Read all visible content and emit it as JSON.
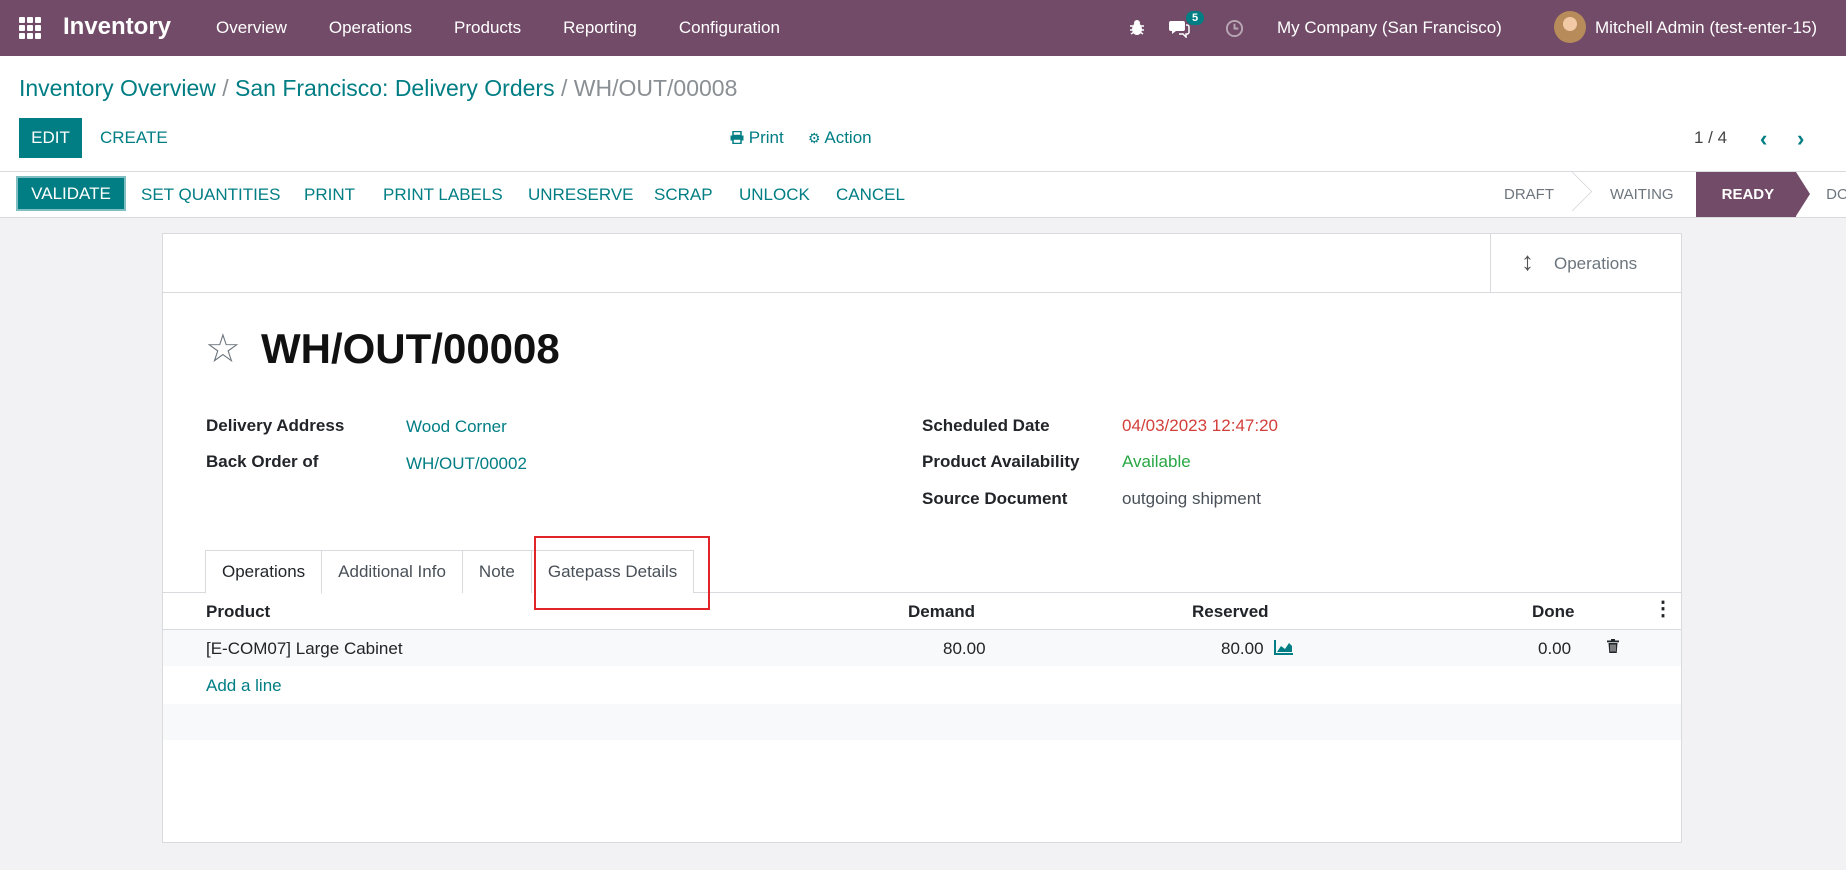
{
  "navbar": {
    "brand": "Inventory",
    "menu": [
      "Overview",
      "Operations",
      "Products",
      "Reporting",
      "Configuration"
    ],
    "messages_count": "5",
    "company": "My Company (San Francisco)",
    "user": "Mitchell Admin (test-enter-15)"
  },
  "breadcrumb": {
    "level1": "Inventory Overview",
    "level2": "San Francisco: Delivery Orders",
    "current": "WH/OUT/00008",
    "sep": "/"
  },
  "controls": {
    "edit": "EDIT",
    "create": "CREATE",
    "print": "Print",
    "action": "Action",
    "pager": "1 / 4"
  },
  "statusbar": {
    "buttons": [
      "VALIDATE",
      "SET QUANTITIES",
      "PRINT",
      "PRINT LABELS",
      "UNRESERVE",
      "SCRAP",
      "UNLOCK",
      "CANCEL"
    ],
    "states": [
      "DRAFT",
      "WAITING",
      "READY",
      "DONE"
    ],
    "active_state": "READY"
  },
  "form": {
    "smart_button": "Operations",
    "title": "WH/OUT/00008",
    "fields": {
      "delivery_address_label": "Delivery Address",
      "delivery_address": "Wood Corner",
      "back_order_label": "Back Order of",
      "back_order": "WH/OUT/00002",
      "scheduled_date_label": "Scheduled Date",
      "scheduled_date": "04/03/2023 12:47:20",
      "availability_label": "Product Availability",
      "availability": "Available",
      "source_label": "Source Document",
      "source": "outgoing shipment"
    },
    "tabs": [
      "Operations",
      "Additional Info",
      "Note",
      "Gatepass Details"
    ],
    "table": {
      "headers": [
        "Product",
        "Demand",
        "Reserved",
        "Done"
      ],
      "rows": [
        {
          "product": "[E-COM07] Large Cabinet",
          "demand": "80.00",
          "reserved": "80.00",
          "done": "0.00"
        }
      ],
      "add_line": "Add a line"
    }
  },
  "colors": {
    "brand": "#714b67",
    "accent": "#017e84",
    "highlight": "#e0242a"
  }
}
